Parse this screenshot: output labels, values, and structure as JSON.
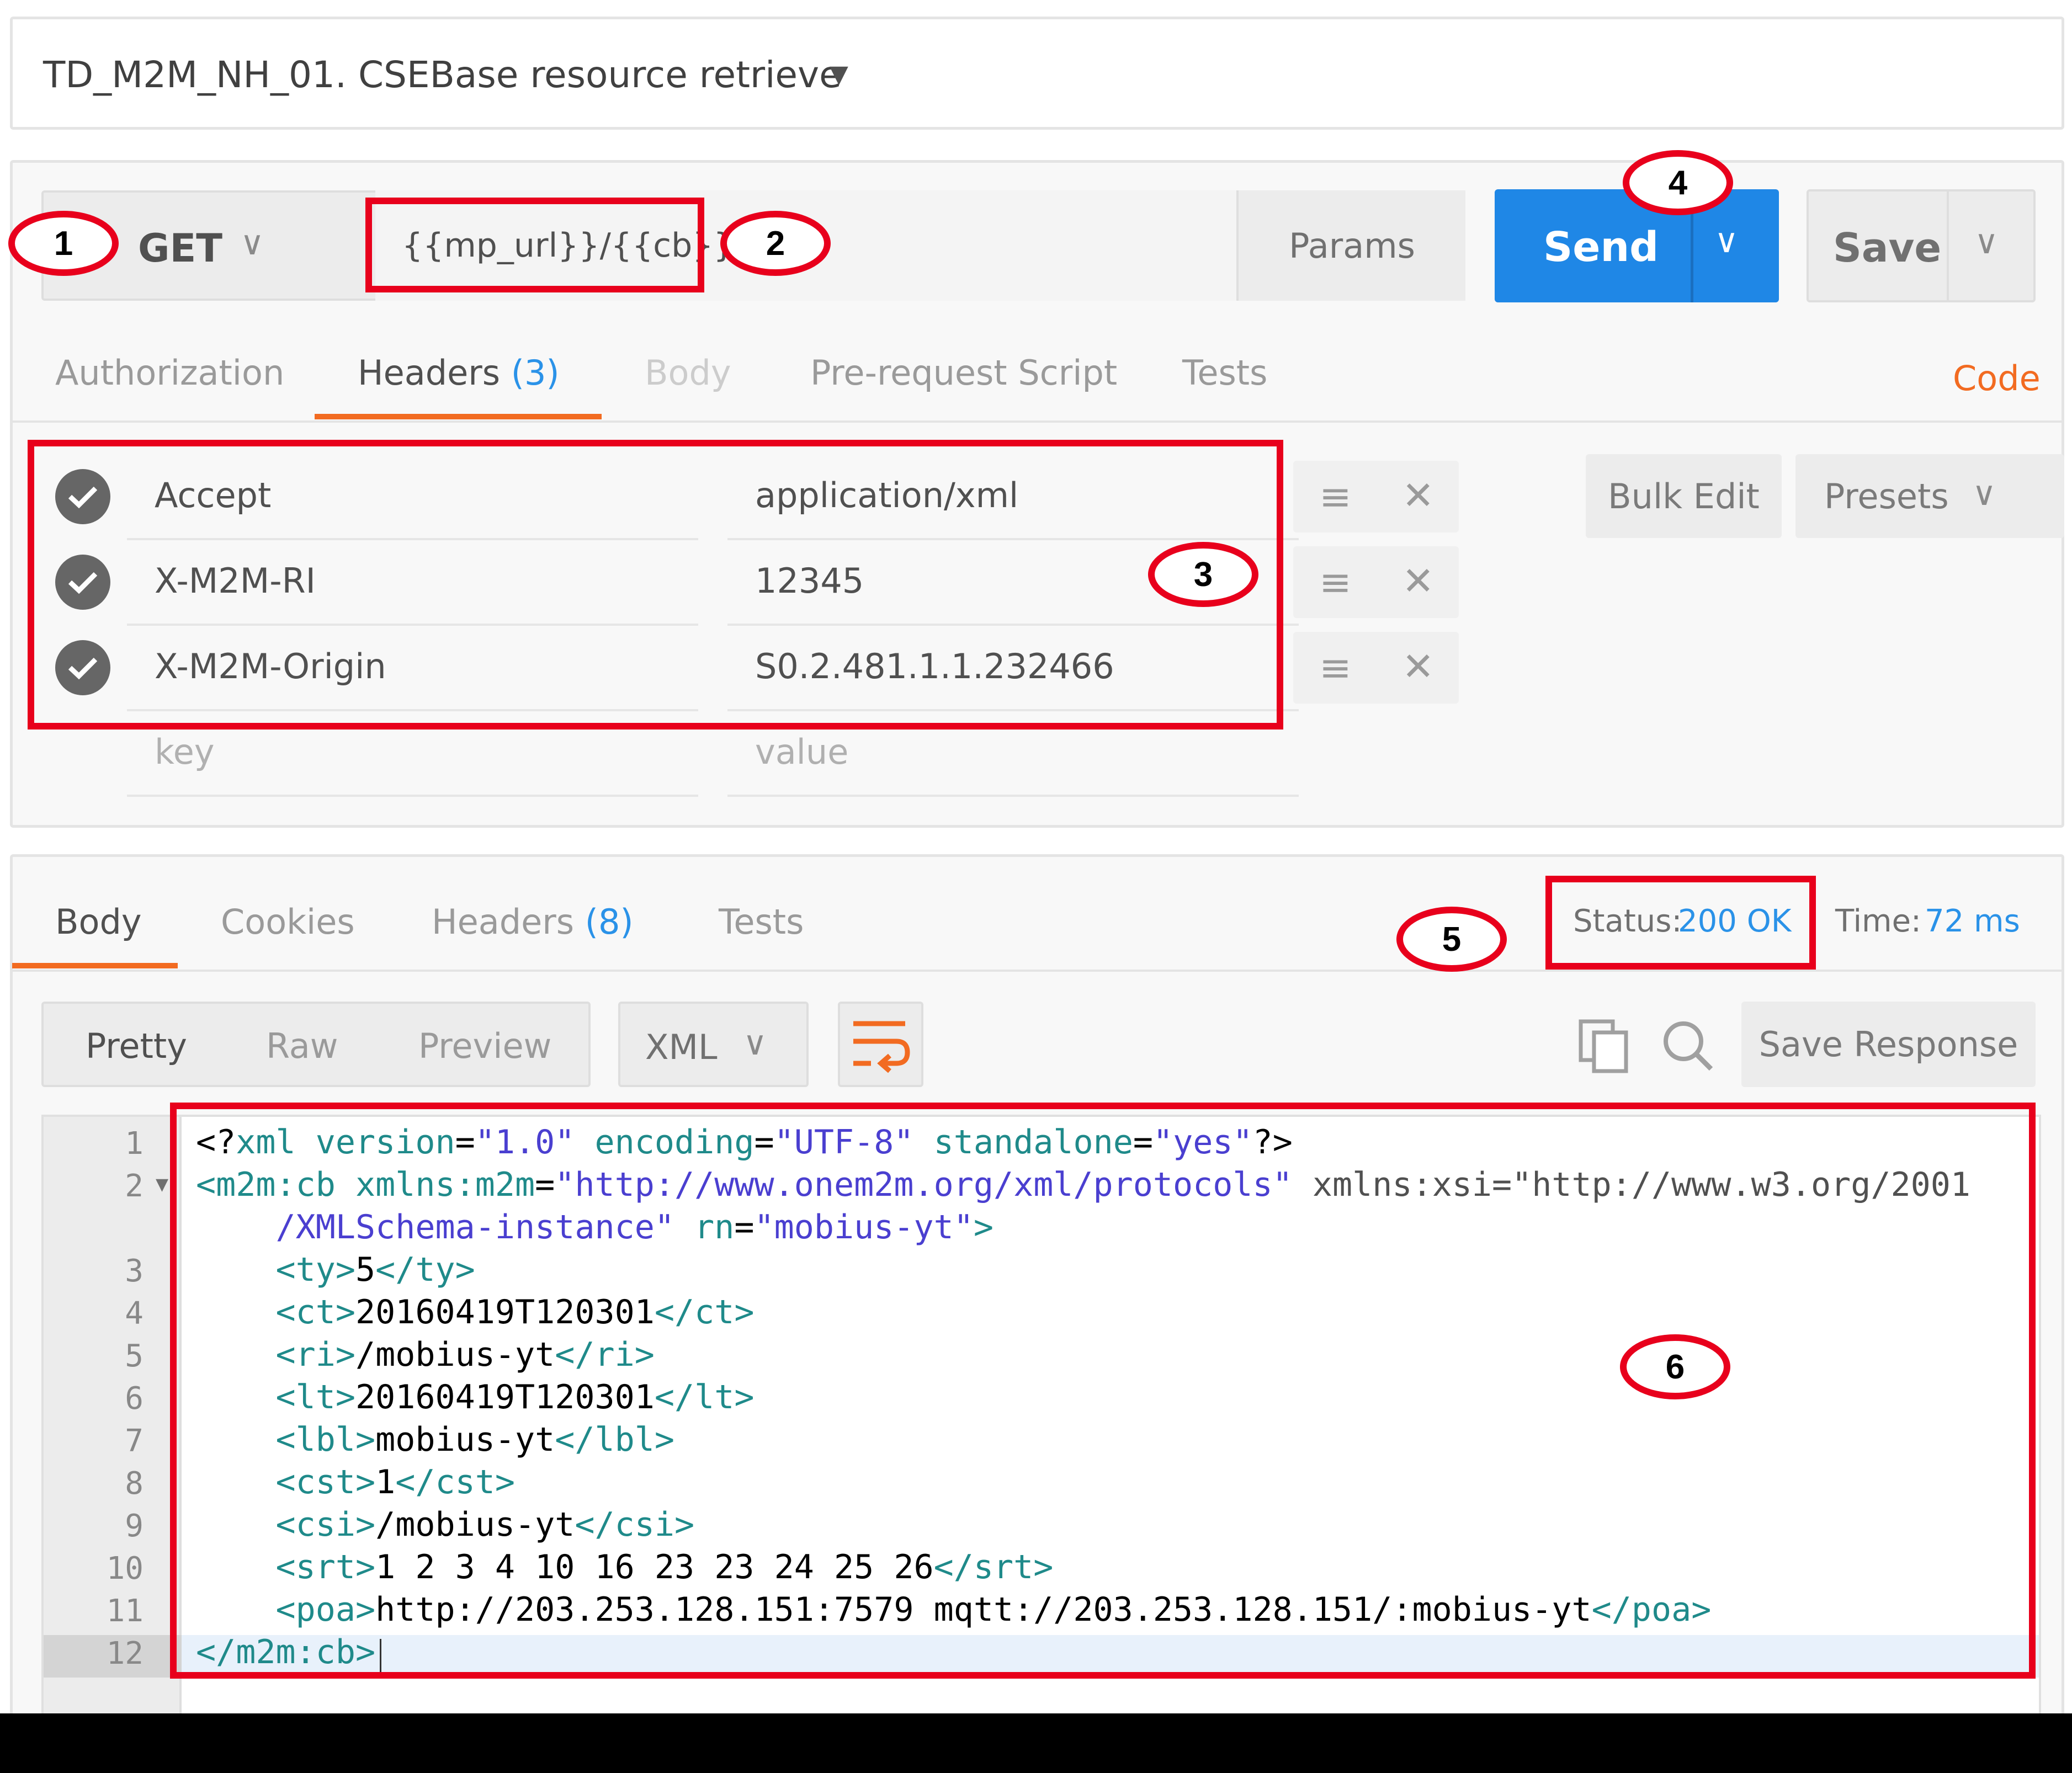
{
  "request_title": "TD_M2M_NH_01. CSEBase resource retrieve",
  "request": {
    "method": "GET",
    "url": "{{mp_url}}/{{cb}}",
    "params_label": "Params",
    "send_label": "Send",
    "save_label": "Save"
  },
  "request_tabs": {
    "authorization": "Authorization",
    "headers": "Headers",
    "headers_count": "(3)",
    "body": "Body",
    "prerequest": "Pre-request Script",
    "tests": "Tests",
    "code": "Code"
  },
  "headers": [
    {
      "key": "Accept",
      "value": "application/xml"
    },
    {
      "key": "X-M2M-RI",
      "value": "12345"
    },
    {
      "key": "X-M2M-Origin",
      "value": "S0.2.481.1.1.232466"
    }
  ],
  "header_placeholders": {
    "key": "key",
    "value": "value"
  },
  "header_actions": {
    "bulk_edit": "Bulk Edit",
    "presets": "Presets"
  },
  "response_tabs": {
    "body": "Body",
    "cookies": "Cookies",
    "headers": "Headers",
    "headers_count": "(8)",
    "tests": "Tests"
  },
  "response_status": {
    "status_label": "Status:",
    "status_value": "200 OK",
    "time_label": "Time:",
    "time_value": "72 ms"
  },
  "response_view": {
    "pretty": "Pretty",
    "raw": "Raw",
    "preview": "Preview",
    "format": "XML",
    "save_response": "Save Response"
  },
  "code_lines": [
    {
      "n": "1",
      "text": "<?xml version=\"1.0\" encoding=\"UTF-8\" standalone=\"yes\"?>"
    },
    {
      "n": "2",
      "text": "<m2m:cb xmlns:m2m=\"http://www.onem2m.org/xml/protocols\" xmlns:xsi=\"http://www.w3.org/2001"
    },
    {
      "n": "",
      "text": "/XMLSchema-instance\" rn=\"mobius-yt\">"
    },
    {
      "n": "3",
      "text": "<ty>5</ty>"
    },
    {
      "n": "4",
      "text": "<ct>20160419T120301</ct>"
    },
    {
      "n": "5",
      "text": "<ri>/mobius-yt</ri>"
    },
    {
      "n": "6",
      "text": "<lt>20160419T120301</lt>"
    },
    {
      "n": "7",
      "text": "<lbl>mobius-yt</lbl>"
    },
    {
      "n": "8",
      "text": "<cst>1</cst>"
    },
    {
      "n": "9",
      "text": "<csi>/mobius-yt</csi>"
    },
    {
      "n": "10",
      "text": "<srt>1 2 3 4 10 16 23 23 24 25 26</srt>"
    },
    {
      "n": "11",
      "text": "<poa>http://203.253.128.151:7579 mqtt://203.253.128.151/:mobius-yt</poa>"
    },
    {
      "n": "12",
      "text": "</m2m:cb>"
    }
  ],
  "callouts": [
    "1",
    "2",
    "3",
    "4",
    "5",
    "6"
  ],
  "colors": {
    "accent_blue": "#1f87e6",
    "annotation_red": "#e8001c",
    "tab_orange": "#f26b21"
  }
}
